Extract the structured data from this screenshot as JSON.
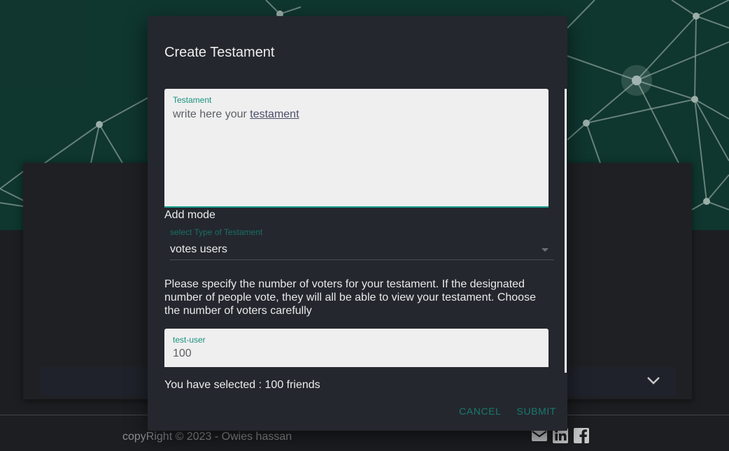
{
  "dialog": {
    "title": "Create Testament",
    "testament_field": {
      "label": "Testament",
      "value_prefix": "write here your ",
      "value_link": "testament"
    },
    "add_mode_label": "Add mode",
    "type_select": {
      "label": "select Type of Testament",
      "value": "votes users"
    },
    "info_text": "Please specify the number of voters for your testament. If the designated number of people vote, they will all be able to view your testament. Choose the number of voters carefully",
    "user_field": {
      "label": "test-user",
      "value": "100"
    },
    "selected_text": "You have selected : 100 friends",
    "actions": {
      "cancel_label": "CANCEL",
      "submit_label": "SUBMIT"
    }
  },
  "footer": {
    "copyright": "copyRight © 2023 - Owies hassan",
    "social_icons": [
      "mail-icon",
      "linkedin-icon",
      "facebook-icon"
    ]
  },
  "colors": {
    "accent": "#1aa08f",
    "dialog_bg": "#24272e",
    "hero_bg": "#113b33"
  }
}
